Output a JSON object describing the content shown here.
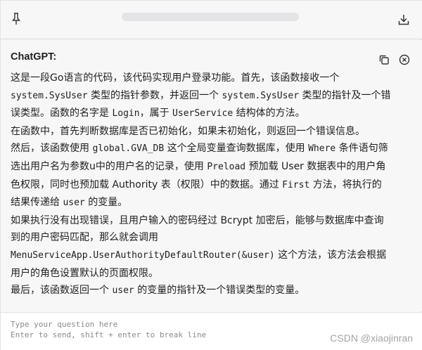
{
  "header": {
    "pin_icon": "pin-icon",
    "download_icon": "download-icon"
  },
  "message": {
    "sender": "ChatGPT:",
    "copy_icon": "copy-icon",
    "close_icon": "close-circle-icon",
    "lines": [
      {
        "t": "这是一段Go语言的代码，该代码实现用户登录功能。首先，该函数接收一个"
      },
      {
        "c": "system.SysUser",
        "t": " 类型的指针参数，并返回一个 ",
        "c2": "system.SysUser",
        "t2": " 类型的指针及一个错"
      },
      {
        "t": "误类型。函数的名字是 ",
        "c": "Login",
        "t2": "，属于 ",
        "c2": "UserService",
        "t3": " 结构体的方法。"
      },
      {
        "t": "在函数中，首先判断数据库是否已初始化，如果未初始化，则返回一个错误信息。"
      },
      {
        "t": "然后，该函数使用 ",
        "c": "global.GVA_DB",
        "t2": " 这个全局变量查询数据库，使用 ",
        "c2": "Where",
        "t3": " 条件语句筛"
      },
      {
        "t": "选出用户名为参数u中的用户名的记录，使用 ",
        "c": "Preload",
        "t2": " 预加载 User 数据表中的用户角"
      },
      {
        "t": "色权限，同时也预加载 Authority 表（权限）中的数据。通过 ",
        "c": "First",
        "t2": " 方法，将执行的"
      },
      {
        "t": "结果传递给 ",
        "c": "user",
        "t2": " 的变量。"
      },
      {
        "t": "如果执行没有出现错误，且用户输入的密码经过 Bcrypt 加密后，能够与数据库中查询"
      },
      {
        "t": "到的用户密码匹配，那么就会调用"
      },
      {
        "c": "MenuServiceApp.UserAuthorityDefaultRouter(&user)",
        "t": " 这个方法，该方法会根据"
      },
      {
        "t": "用户的角色设置默认的页面权限。"
      },
      {
        "t": "最后，该函数返回一个 ",
        "c": "user",
        "t2": " 的变量的指针及一个错误类型的变量。"
      }
    ]
  },
  "input": {
    "placeholder": "Type your question here\nEnter to send, shift + enter to break line"
  },
  "watermark": "CSDN @xiaojinran"
}
